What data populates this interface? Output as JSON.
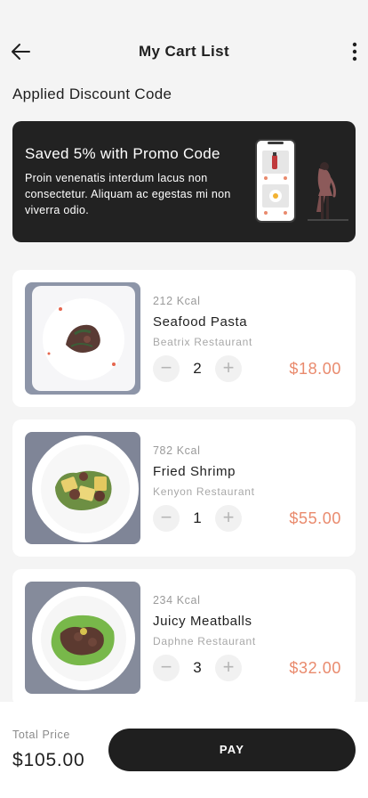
{
  "header": {
    "title": "My Cart List",
    "back_icon": "arrow-left-icon",
    "menu_icon": "more-vertical-icon"
  },
  "discount": {
    "section_label": "Applied Discount Code",
    "promo_title": "Saved 5% with Promo Code",
    "promo_text": "Proin venenatis interdum lacus non consectetur. Aliquam ac egestas mi non viverra odio."
  },
  "items": [
    {
      "kcal": "212 Kcal",
      "name": "Seafood Pasta",
      "restaurant": "Beatrix Restaurant",
      "qty": "2",
      "price": "$18.00",
      "minus": "−",
      "plus": "+"
    },
    {
      "kcal": "782 Kcal",
      "name": "Fried Shrimp",
      "restaurant": "Kenyon Restaurant",
      "qty": "1",
      "price": "$55.00",
      "minus": "−",
      "plus": "+"
    },
    {
      "kcal": "234 Kcal",
      "name": "Juicy Meatballs",
      "restaurant": "Daphne Restaurant",
      "qty": "3",
      "price": "$32.00",
      "minus": "−",
      "plus": "+"
    }
  ],
  "footer": {
    "total_label": "Total Price",
    "total_value": "$105.00",
    "pay_label": "PAY"
  },
  "colors": {
    "accent": "#e98a6d",
    "dark": "#1f1f1f",
    "background": "#f4f4f4"
  }
}
